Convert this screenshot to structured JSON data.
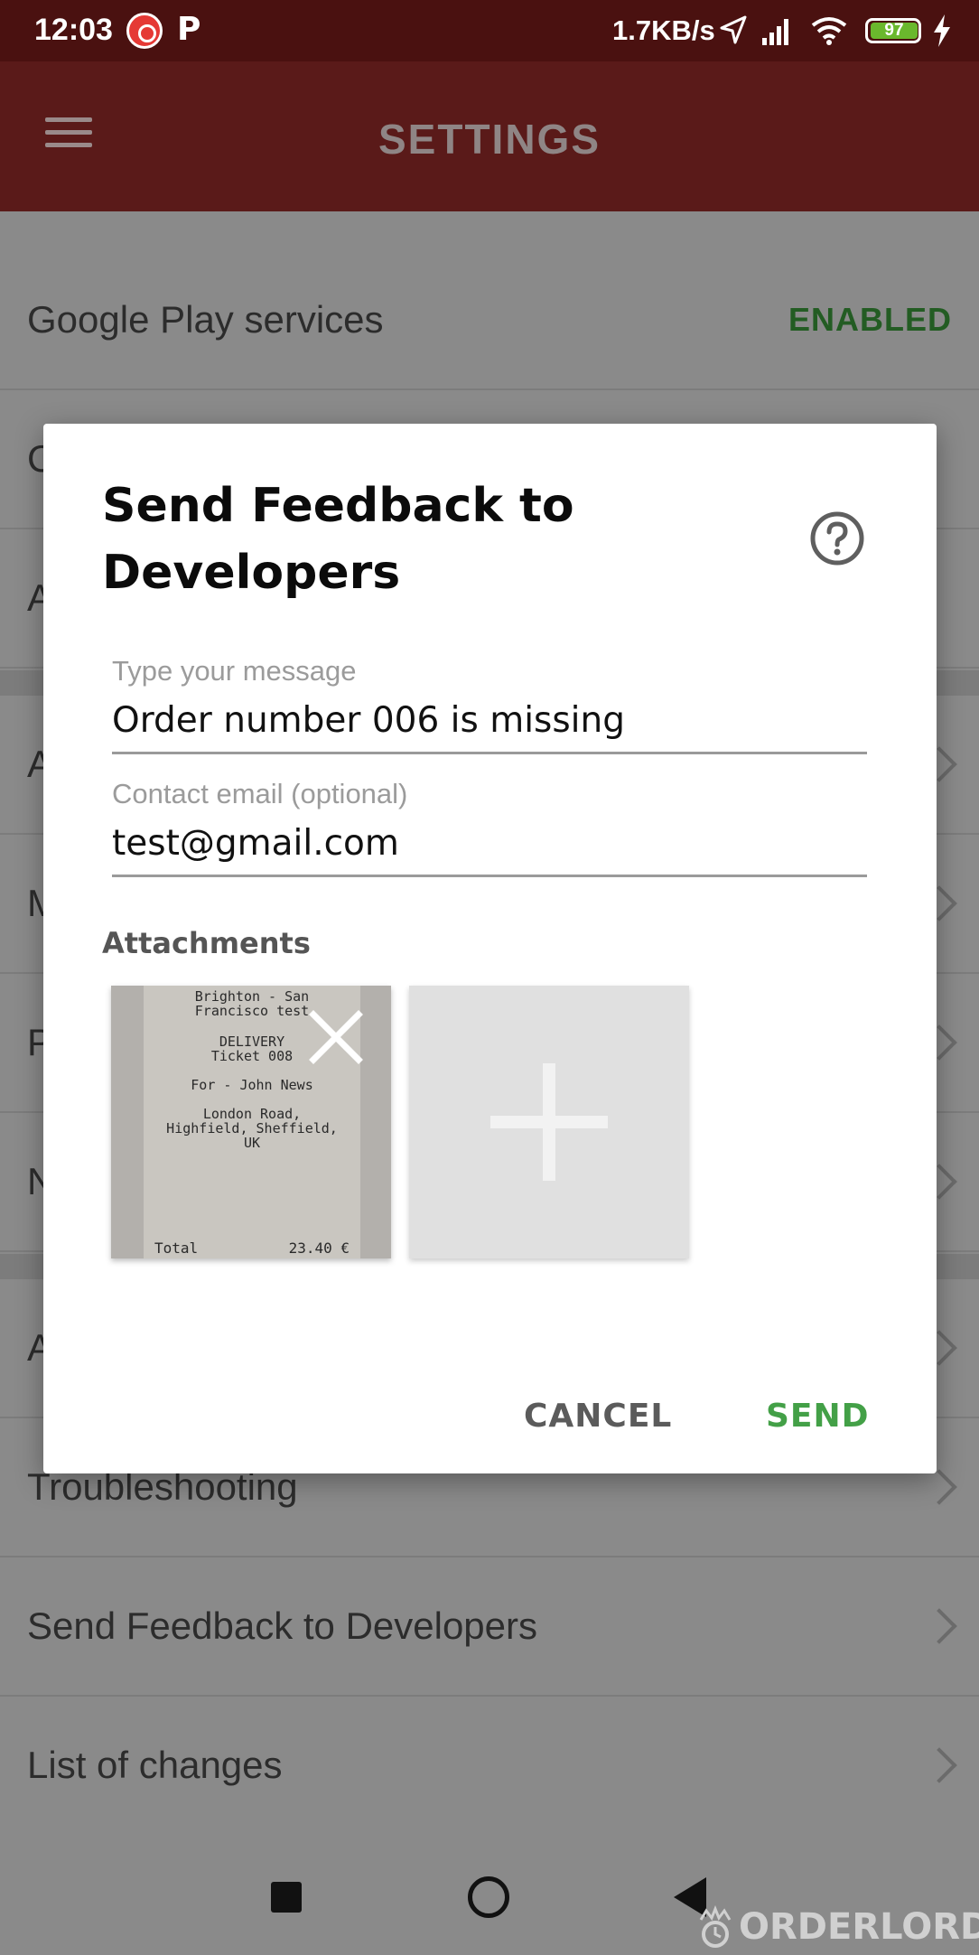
{
  "status_bar": {
    "time": "12:03",
    "app_letter": "P",
    "net_speed": "1.7KB/s",
    "battery": "97"
  },
  "app_bar": {
    "title": "SETTINGS"
  },
  "settings": {
    "row_google_play": {
      "label": "Google Play services",
      "value": "ENABLED"
    },
    "row_troubleshooting": {
      "label": "Troubleshooting"
    },
    "row_send_feedback": {
      "label": "Send Feedback to Developers"
    },
    "row_list_changes": {
      "label": "List of changes"
    },
    "partial_initials": [
      "C",
      "A",
      "A",
      "M",
      "P",
      "N",
      "A"
    ]
  },
  "dialog": {
    "title": "Send Feedback to Developers",
    "message_label": "Type your message",
    "message_value": "Order number 006 is missing",
    "email_label": "Contact email (optional)",
    "email_value": "test@gmail.com",
    "attachments_title": "Attachments",
    "receipt": {
      "l1": "Brighton - San",
      "l2": "Francisco test",
      "l3": "DELIVERY",
      "l4": "Ticket 008",
      "l5": "For - John News",
      "l6": "London Road,",
      "l7": "Highfield, Sheffield,",
      "l8": "UK",
      "total_label": "Total",
      "total_value": "23.40 €"
    },
    "cancel_label": "CANCEL",
    "send_label": "SEND"
  },
  "watermark": "ORDERLORD",
  "colors": {
    "app_bar": "#5a1a19",
    "status_bar": "#4a1110",
    "enabled": "#235c23",
    "send": "#43a047"
  }
}
